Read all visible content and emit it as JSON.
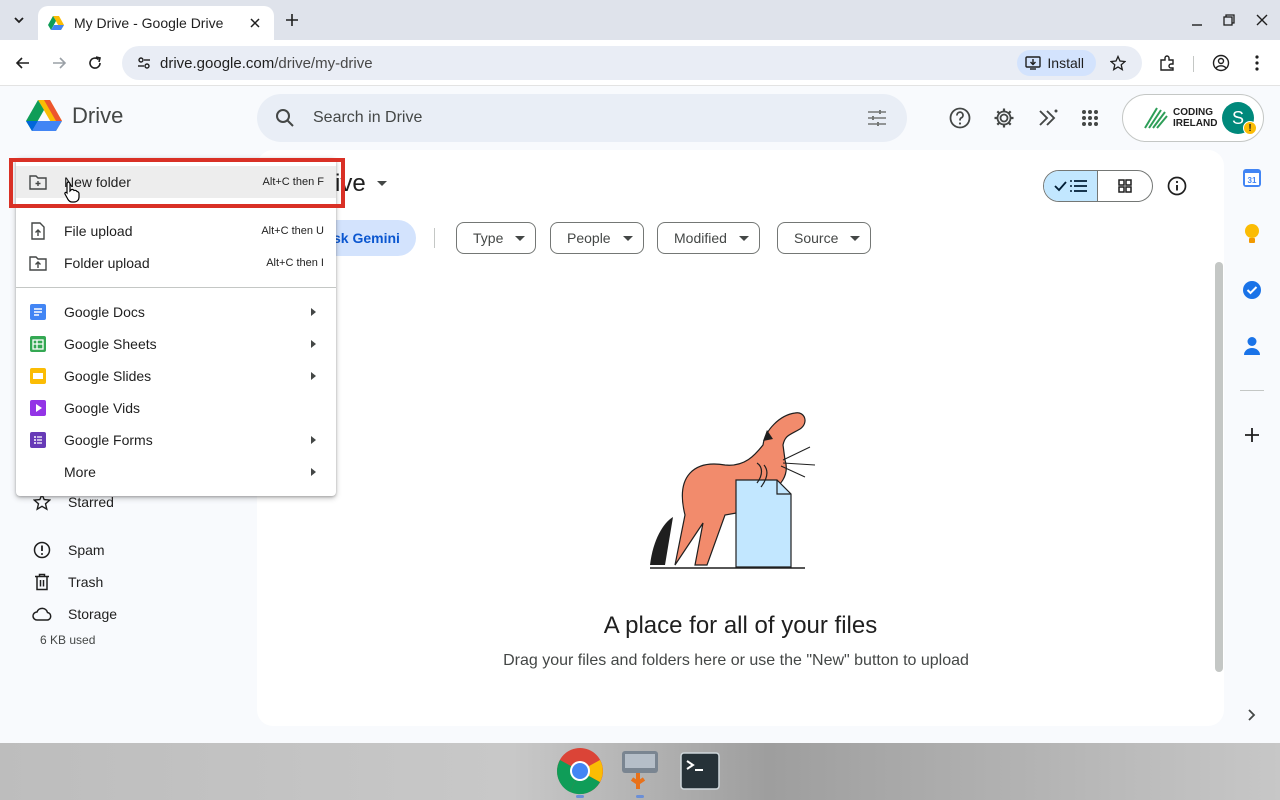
{
  "browser": {
    "tab_title": "My Drive - Google Drive",
    "url_host": "drive.google.com",
    "url_path": "/drive/my-drive",
    "install_label": "Install"
  },
  "header": {
    "app_name": "Drive",
    "search_placeholder": "Search in Drive",
    "org_line1": "CODING",
    "org_line2": "IRELAND",
    "avatar_initial": "S",
    "avatar_badge": "!"
  },
  "main": {
    "title_partial": "rive",
    "gemini_partial": "sk Gemini",
    "filters": [
      "Type",
      "People",
      "Modified",
      "Source"
    ],
    "empty_title": "A place for all of your files",
    "empty_subtitle": "Drag your files and folders here or use the \"New\" button to upload"
  },
  "sidebar": {
    "items": [
      {
        "label": "Starred",
        "icon": "star-icon"
      },
      {
        "label": "Spam",
        "icon": "spam-icon"
      },
      {
        "label": "Trash",
        "icon": "trash-icon"
      },
      {
        "label": "Storage",
        "icon": "cloud-icon"
      }
    ],
    "storage_used": "6 KB used"
  },
  "menu": {
    "items": [
      {
        "label": "New folder",
        "shortcut": "Alt+C then F",
        "icon": "new-folder-icon"
      },
      {
        "label": "File upload",
        "shortcut": "Alt+C then U",
        "icon": "file-upload-icon"
      },
      {
        "label": "Folder upload",
        "shortcut": "Alt+C then I",
        "icon": "folder-upload-icon"
      },
      {
        "label": "Google Docs",
        "icon": "docs-icon",
        "color": "#4285f4"
      },
      {
        "label": "Google Sheets",
        "icon": "sheets-icon",
        "color": "#34a853"
      },
      {
        "label": "Google Slides",
        "icon": "slides-icon",
        "color": "#fbbc04"
      },
      {
        "label": "Google Vids",
        "icon": "vids-icon",
        "color": "#9334e6"
      },
      {
        "label": "Google Forms",
        "icon": "forms-icon",
        "color": "#673ab7"
      },
      {
        "label": "More",
        "icon": ""
      }
    ]
  },
  "colors": {
    "accent": "#0b57d0",
    "highlight": "#d93025",
    "chip_bg": "#d3e3fd"
  }
}
